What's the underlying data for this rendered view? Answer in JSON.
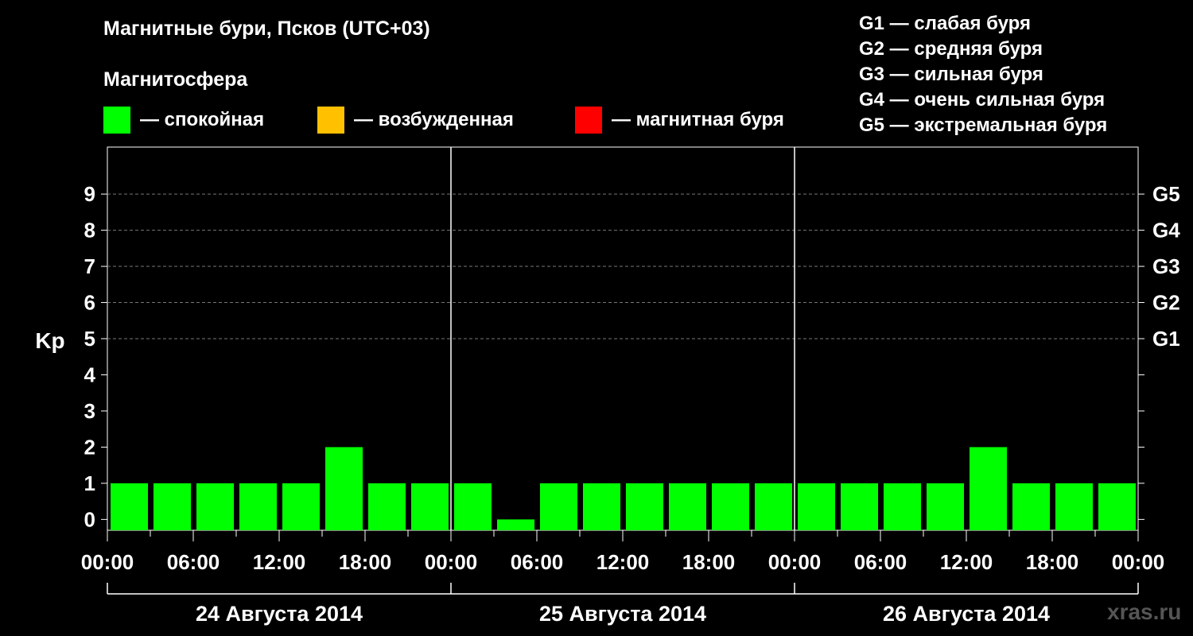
{
  "header": {
    "title": "Магнитные бури, Псков (UTC+03)",
    "subtitle": "Магнитосфера"
  },
  "legend": [
    {
      "label": "— спокойная",
      "color": "#00ff00"
    },
    {
      "label": "— возбужденная",
      "color": "#ffc000"
    },
    {
      "label": "— магнитная буря",
      "color": "#ff0000"
    }
  ],
  "storm_levels": [
    "G1 — слабая буря",
    "G2 — средняя буря",
    "G3 — сильная буря",
    "G4 — очень сильная буря",
    "G5 — экстремальная буря"
  ],
  "watermark": "xras.ru",
  "chart_data": {
    "type": "bar",
    "ylabel": "Kp",
    "ylim": [
      -0.3,
      10.3
    ],
    "yticks": [
      "0",
      "1",
      "2",
      "3",
      "4",
      "5",
      "6",
      "7",
      "8",
      "9"
    ],
    "right_ticks": [
      {
        "kp": 5,
        "label": "G1"
      },
      {
        "kp": 6,
        "label": "G2"
      },
      {
        "kp": 7,
        "label": "G3"
      },
      {
        "kp": 8,
        "label": "G4"
      },
      {
        "kp": 9,
        "label": "G5"
      }
    ],
    "grid": "dashed horizontal at Kp 5–9",
    "xticks": [
      "00:00",
      "06:00",
      "12:00",
      "18:00",
      "00:00",
      "06:00",
      "12:00",
      "18:00",
      "00:00",
      "06:00",
      "12:00",
      "18:00",
      "00:00"
    ],
    "days": [
      "24 Августа 2014",
      "25 Августа 2014",
      "26 Августа 2014"
    ],
    "interval_hours": 3,
    "values": [
      1,
      1,
      1,
      1,
      1,
      2,
      1,
      1,
      1,
      0,
      1,
      1,
      1,
      1,
      1,
      1,
      1,
      1,
      1,
      1,
      2,
      1,
      1,
      1
    ],
    "bar_color": "#00ff00"
  }
}
